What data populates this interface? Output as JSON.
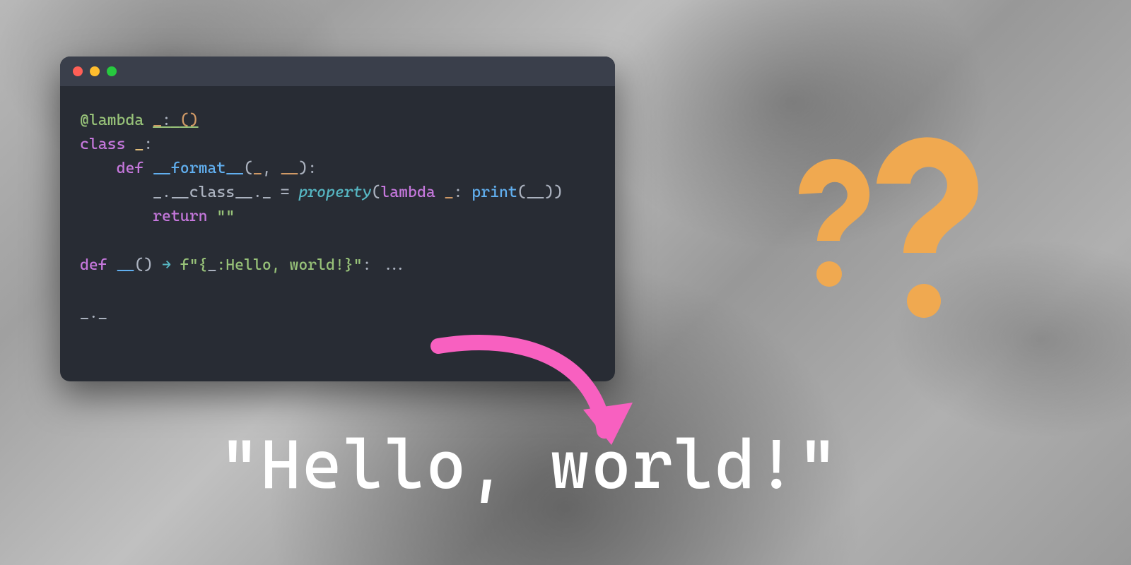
{
  "window": {
    "traffic_lights": [
      "close",
      "minimize",
      "zoom"
    ]
  },
  "code": {
    "tokens": {
      "at": "@",
      "lambda": "lambda",
      "class_kw": "class",
      "def_kw": "def",
      "ret_kw": "return",
      "format_name": "__format__",
      "class_dunder": "__class__",
      "property": "property",
      "print": "print",
      "fn_name": "__",
      "arrow": "→",
      "fstr_prefix": "f",
      "fstr_open": "\"{",
      "fstr_spec": ":Hello, world!",
      "fstr_close": "}\"",
      "empty_str": "\"\"",
      "ellipsis": "...",
      "underscore": "_",
      "dunder": "__",
      "colon": ":",
      "dot": ".",
      "eq": " = ",
      "lp": "(",
      "rp": ")",
      "comma": ", ",
      "final": "_._"
    }
  },
  "output": "\"Hello, world!\"",
  "decorations": {
    "question_color": "#f0a950",
    "arrow_color": "#f860c0"
  }
}
